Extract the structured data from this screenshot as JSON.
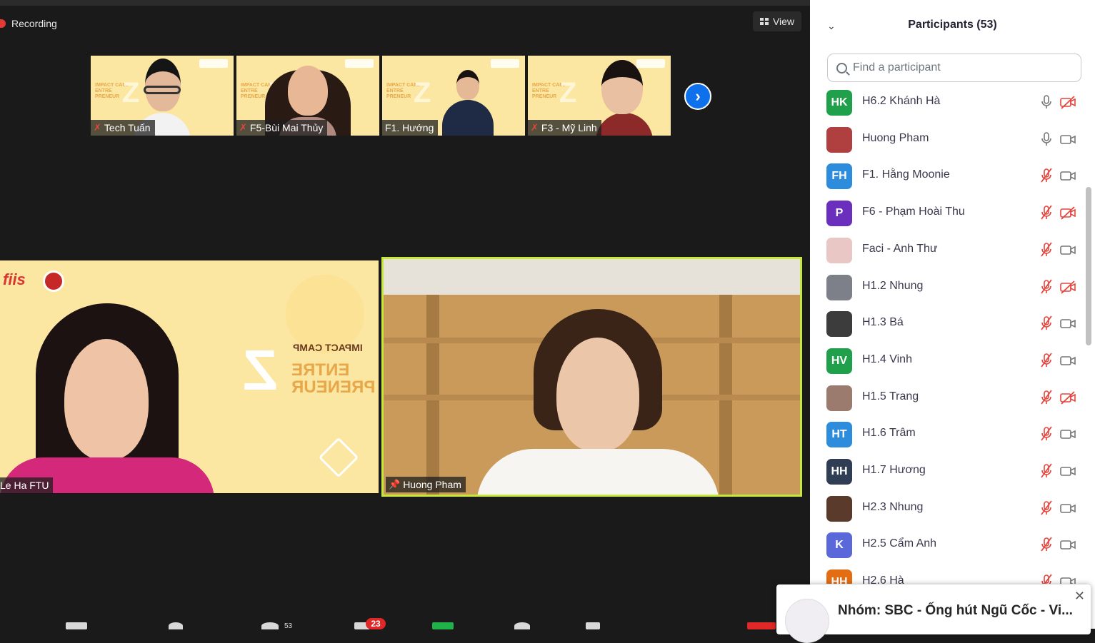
{
  "recording": {
    "label": "Recording"
  },
  "view_button": {
    "label": "View"
  },
  "thumbnails": [
    {
      "name": "Tech Tuấn",
      "muted": true
    },
    {
      "name": "F5-Bùi Mai Thủy",
      "muted": true
    },
    {
      "name": "F1. Hướng",
      "muted": false
    },
    {
      "name": "F3 - Mỹ Linh",
      "muted": true
    }
  ],
  "thumb_branding": {
    "camp": "IMPACT CAMP",
    "entre": "ENTRE",
    "preneur": "PRENEUR",
    "z": "Z",
    "brand": "fiis"
  },
  "main_videos": {
    "left": {
      "name": "Le Ha FTU",
      "backdrop_camp": "IMPACT CAMP",
      "backdrop_entre": "ENTRE",
      "backdrop_preneur": "PRENEUR",
      "backdrop_z": "Z",
      "brand": "fiis"
    },
    "right": {
      "name": "Huong Pham",
      "pinned": true
    }
  },
  "toolbar": {
    "participants_count": "53",
    "chat_badge": "23"
  },
  "panel": {
    "title": "Participants (53)",
    "search_placeholder": "Find a participant",
    "participants": [
      {
        "initials": "HK",
        "name": "H6.2 Khánh Hà",
        "avatar_color": "#21a04b",
        "mic": "on",
        "video": "off"
      },
      {
        "initials": "",
        "name": "Huong Pham",
        "avatar_color": "#b04040",
        "mic": "on",
        "video": "on"
      },
      {
        "initials": "FH",
        "name": "F1. Hằng Moonie",
        "avatar_color": "#2d8cdc",
        "mic": "muted",
        "video": "on"
      },
      {
        "initials": "P",
        "name": "F6 - Phạm Hoài Thu",
        "avatar_color": "#6b2fbd",
        "mic": "muted",
        "video": "off"
      },
      {
        "initials": "",
        "name": "Faci - Anh Thư",
        "avatar_color": "#e8c7c5",
        "mic": "muted",
        "video": "on"
      },
      {
        "initials": "",
        "name": "H1.2 Nhung",
        "avatar_color": "#7d8089",
        "mic": "muted",
        "video": "off"
      },
      {
        "initials": "",
        "name": "H1.3 Bá",
        "avatar_color": "#3c3c3c",
        "mic": "muted",
        "video": "on"
      },
      {
        "initials": "HV",
        "name": "H1.4 Vinh",
        "avatar_color": "#21a04b",
        "mic": "muted",
        "video": "on"
      },
      {
        "initials": "",
        "name": "H1.5 Trang",
        "avatar_color": "#9a7b6d",
        "mic": "muted",
        "video": "off"
      },
      {
        "initials": "HT",
        "name": "H1.6 Trâm",
        "avatar_color": "#2d8cdc",
        "mic": "muted",
        "video": "on"
      },
      {
        "initials": "HH",
        "name": "H1.7 Hương",
        "avatar_color": "#2f3e55",
        "mic": "muted",
        "video": "on"
      },
      {
        "initials": "",
        "name": "H2.3 Nhung",
        "avatar_color": "#5a3a2a",
        "mic": "muted",
        "video": "on"
      },
      {
        "initials": "K",
        "name": "H2.5 Cẩm Anh",
        "avatar_color": "#5b68d9",
        "mic": "muted",
        "video": "on"
      },
      {
        "initials": "HH",
        "name": "H2.6 Hà",
        "avatar_color": "#e36d13",
        "mic": "muted",
        "video": "on"
      }
    ]
  },
  "notification": {
    "text": "Nhóm: SBC - Ống hút Ngũ Cốc - Vi..."
  },
  "colors": {
    "active_speaker": "#c6e83e",
    "accent_blue": "#0e71eb",
    "muted_red": "#e5453c",
    "badge_red": "#e02828"
  }
}
